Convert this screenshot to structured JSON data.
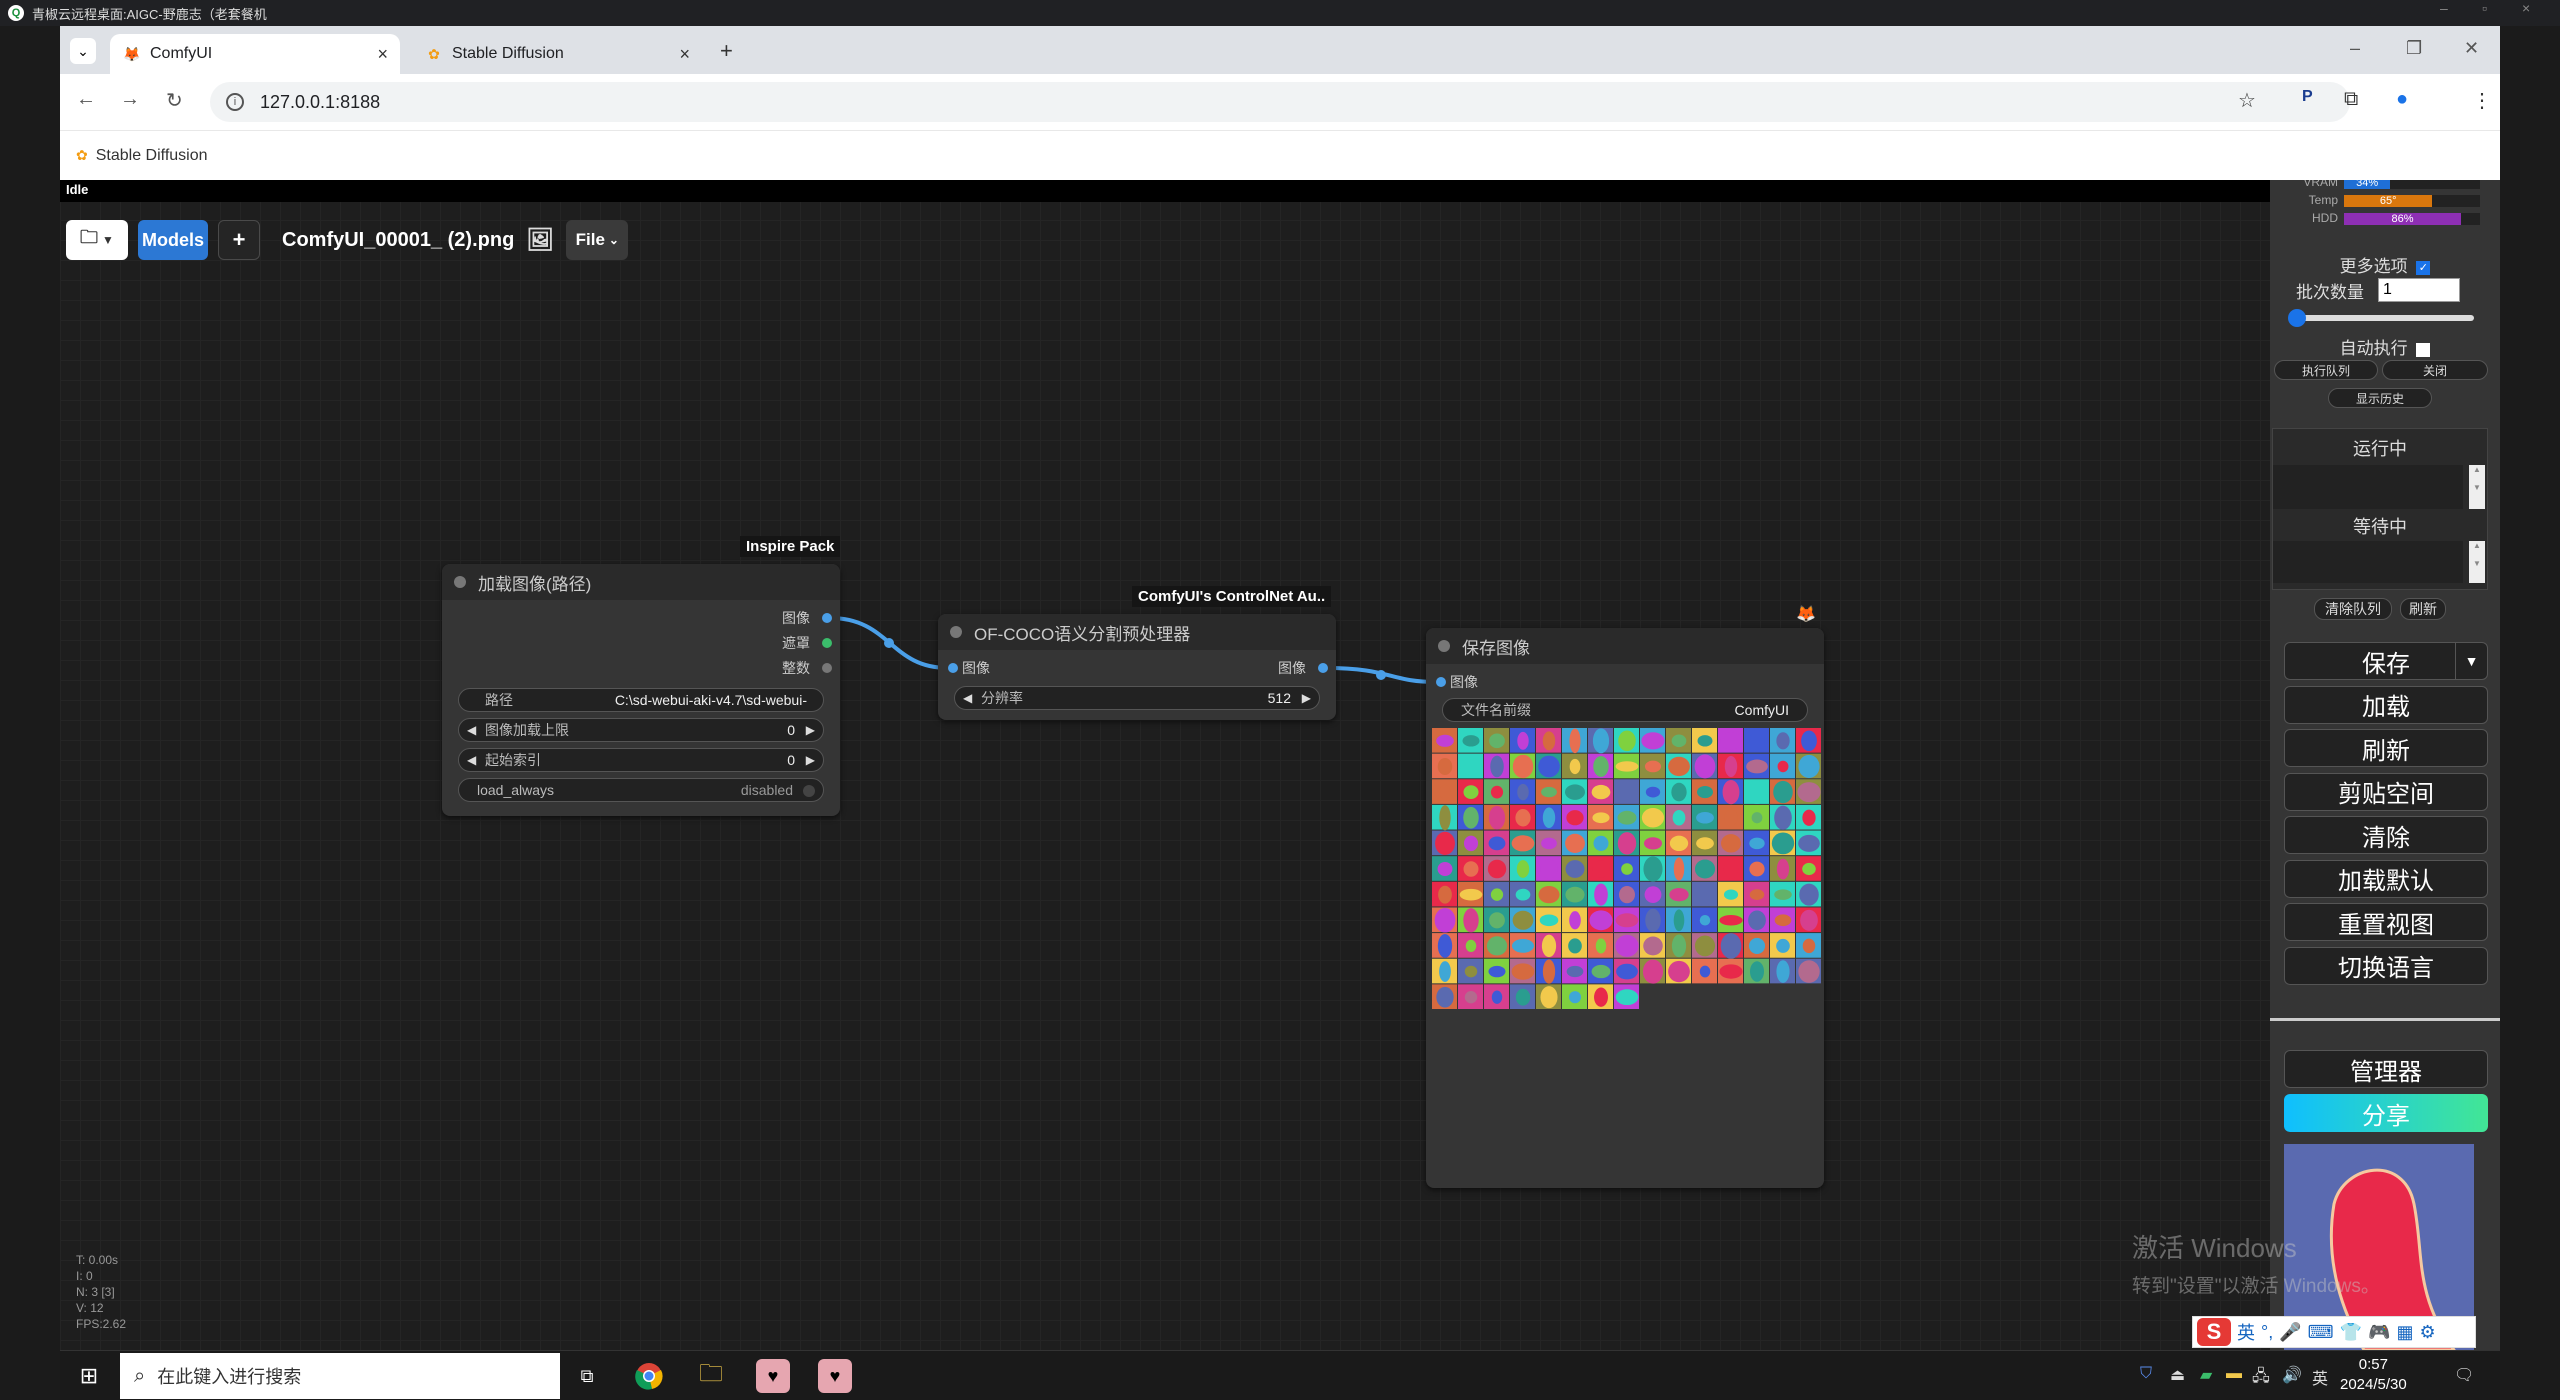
{
  "remote_desktop": {
    "title": "青椒云远程桌面:AIGC-野鹿志（老套餐机"
  },
  "browser": {
    "tabs": [
      {
        "label": "ComfyUI",
        "icon": "comfyui-fox-icon"
      },
      {
        "label": "Stable Diffusion",
        "icon": "stable-diffusion-icon"
      }
    ],
    "url": "127.0.0.1:8188",
    "bookmarks": [
      {
        "label": "Stable Diffusion"
      }
    ]
  },
  "comfy": {
    "status": "Idle",
    "topmenu": {
      "models_label": "Models",
      "plus_label": "+",
      "workflow_name": "ComfyUI_00001_ (2).png",
      "file_label": "File"
    },
    "nodes": {
      "load_image": {
        "badge": "Inspire Pack",
        "title": "加载图像(路径)",
        "outputs": [
          "图像",
          "遮罩",
          "整数"
        ],
        "widgets": [
          {
            "label": "路径",
            "value": "C:\\sd-webui-aki-v4.7\\sd-webui-"
          },
          {
            "label": "图像加载上限",
            "value": "0"
          },
          {
            "label": "起始索引",
            "value": "0"
          },
          {
            "label": "load_always",
            "value": "disabled"
          }
        ]
      },
      "ofcoco": {
        "badge": "ComfyUI's ControlNet Au..",
        "title": "OF-COCO语义分割预处理器",
        "input": "图像",
        "output": "图像",
        "widgets": [
          {
            "label": "分辨率",
            "value": "512"
          }
        ]
      },
      "save_image": {
        "title": "保存图像",
        "input": "图像",
        "widgets": [
          {
            "label": "文件名前缀",
            "value": "ComfyUI"
          }
        ]
      }
    },
    "stats": {
      "t": "T: 0.00s",
      "i": "I: 0",
      "n": "N: 3 [3]",
      "v": "V: 12",
      "fps": "FPS:2.62"
    }
  },
  "side_panel": {
    "meters": [
      {
        "label": "VRAM",
        "percent": 34,
        "text": "34%",
        "color": "#1f6fd6"
      },
      {
        "label": "Temp",
        "percent": 65,
        "text": "65°",
        "color": "#d9770d"
      },
      {
        "label": "HDD",
        "percent": 86,
        "text": "86%",
        "color": "#8e2fb4"
      }
    ],
    "more_options": "更多选项",
    "batch_count_label": "批次数量",
    "batch_count_value": "1",
    "auto_queue": "自动执行",
    "queue_btn": "执行队列",
    "close_btn": "关闭",
    "history_btn": "显示历史",
    "running": "运行中",
    "pending": "等待中",
    "clear_queue": "清除队列",
    "refresh_small": "刷新",
    "buttons": [
      "保存",
      "加载",
      "刷新",
      "剪贴空间",
      "清除",
      "加载默认",
      "重置视图",
      "切换语言"
    ],
    "manager": "管理器",
    "share": "分享"
  },
  "watermark": {
    "line1": "激活 Windows",
    "line2": "转到\"设置\"以激活 Windows。"
  },
  "ime": {
    "lang": "英"
  },
  "taskbar": {
    "search_placeholder": "在此键入进行搜索",
    "time": "0:57",
    "date": "2024/5/30",
    "tray_lang": "英"
  }
}
